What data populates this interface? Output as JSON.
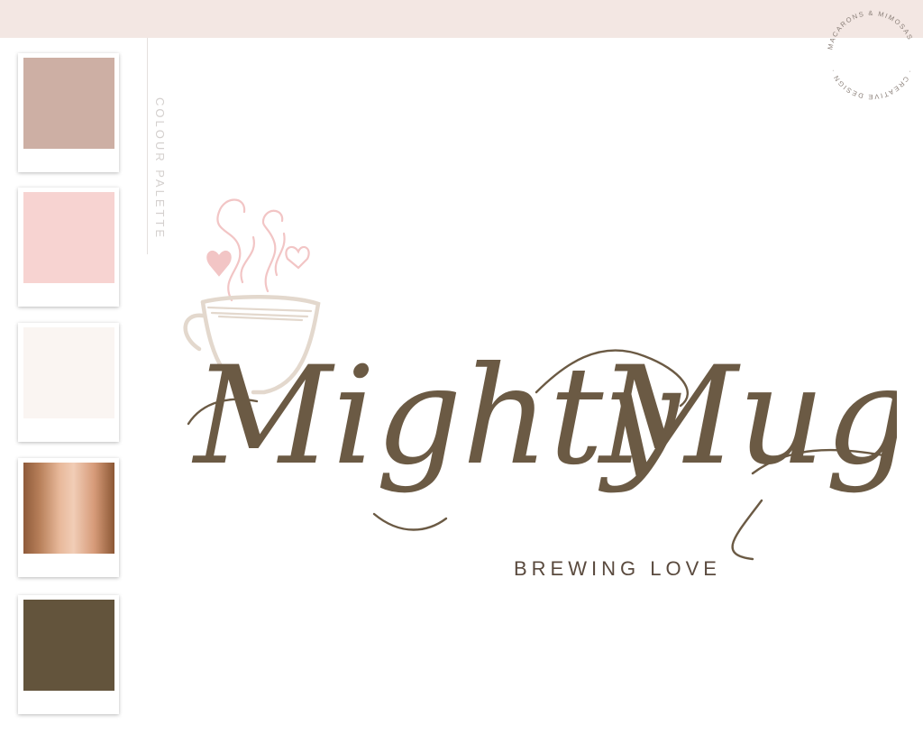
{
  "palette": {
    "label": "COLOUR PALETTE",
    "swatches": [
      {
        "name": "dusty-rose",
        "color": "#cdafa4"
      },
      {
        "name": "blush-pink",
        "color": "#f7d3d1"
      },
      {
        "name": "ivory",
        "color": "#faf5f2"
      },
      {
        "name": "rose-gold",
        "color": "#b8805a"
      },
      {
        "name": "mocha-brown",
        "color": "#63543c"
      }
    ]
  },
  "logo": {
    "name_line1": "Mighty",
    "name_line2": "Mug",
    "tagline": "BREWING LOVE",
    "script_color": "#6b5a44",
    "cup_color": "#e3d8cd",
    "steam_color": "#f2c5c5"
  },
  "stamp": {
    "text_top": "MACARONS & MIMOSAS",
    "text_bottom": "· CREATIVE DESIGN ·"
  },
  "colors": {
    "top_band": "#f3e7e3",
    "background": "#ffffff"
  }
}
